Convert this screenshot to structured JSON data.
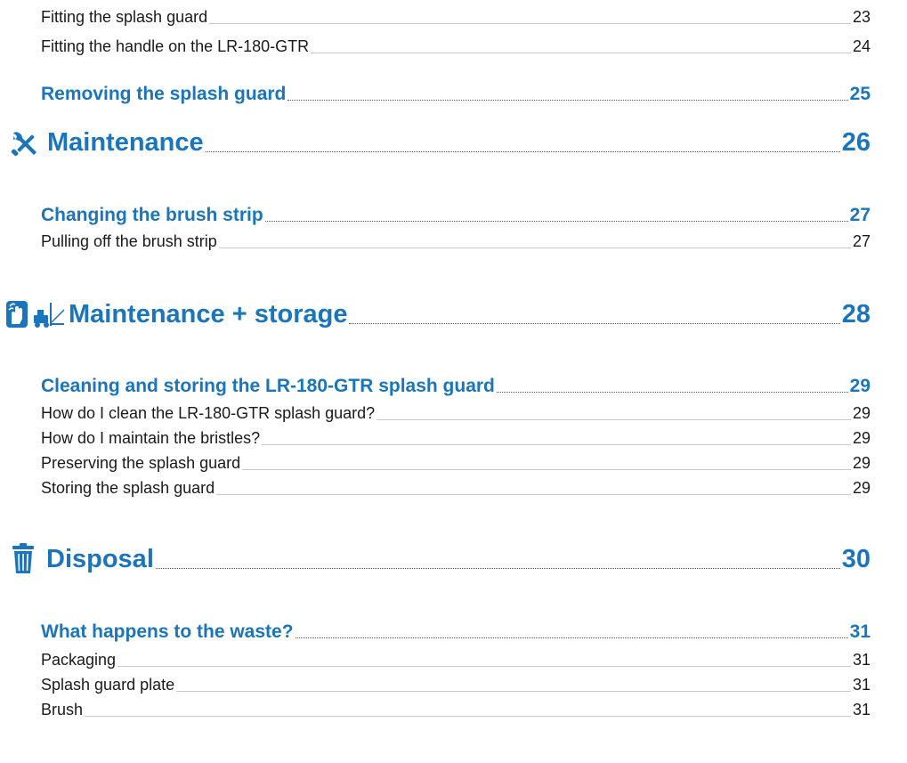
{
  "toc": {
    "e1": {
      "label": "Fitting the splash guard",
      "page": "23"
    },
    "e2": {
      "label": "Fitting the handle on the LR-180-GTR",
      "page": "24"
    },
    "s1": {
      "label": "Removing the splash guard",
      "page": "25"
    },
    "c1": {
      "label": "Maintenance",
      "page": "26",
      "icon": "tools-icon"
    },
    "s2": {
      "label": "Changing the brush strip",
      "page": "27"
    },
    "e3": {
      "label": "Pulling off the brush strip",
      "page": "27"
    },
    "c2": {
      "label": "Maintenance + storage",
      "page": "28",
      "icon": "hand-cleaning-and-forklift-icon"
    },
    "s3": {
      "label": "Cleaning and storing the LR-180-GTR splash guard",
      "page": "29"
    },
    "e4": {
      "label": "How do I clean the LR-180-GTR splash guard?",
      "page": "29"
    },
    "e5": {
      "label": "How do I maintain the bristles?",
      "page": "29"
    },
    "e6": {
      "label": "Preserving the splash guard",
      "page": "29"
    },
    "e7": {
      "label": "Storing the splash guard",
      "page": "29"
    },
    "c3": {
      "label": "Disposal",
      "page": "30",
      "icon": "trash-bin-icon"
    },
    "s4": {
      "label": "What happens to the waste?",
      "page": "31"
    },
    "e8": {
      "label": "Packaging",
      "page": "31"
    },
    "e9": {
      "label": "Splash guard plate",
      "page": "31"
    },
    "e10": {
      "label": "Brush",
      "page": "31"
    }
  },
  "colors": {
    "accent": "#1a75bc",
    "text": "#1a1a1a"
  }
}
